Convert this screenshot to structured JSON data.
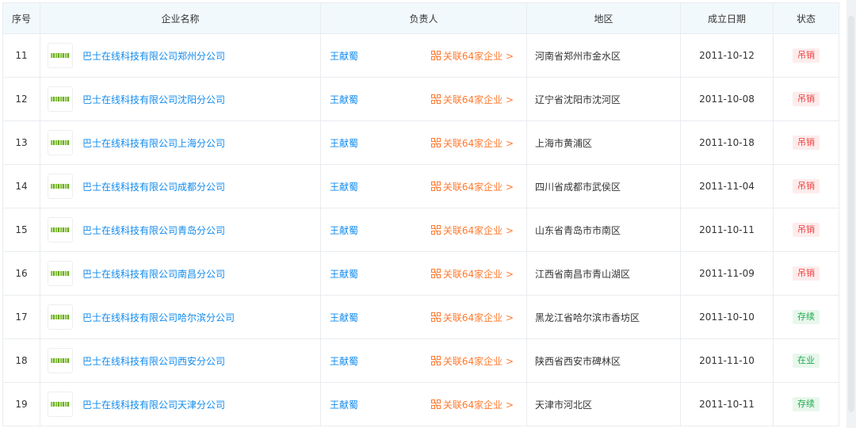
{
  "header": {
    "idx": "序号",
    "name": "企业名称",
    "person": "负责人",
    "region": "地区",
    "date": "成立日期",
    "status": "状态"
  },
  "colors": {
    "link": "#128bed",
    "assoc": "#ff7a30",
    "status_revoked": "#f04040",
    "status_active": "#1eaa4c"
  },
  "rows": [
    {
      "idx": "11",
      "name": "巴士在线科技有限公司郑州分公司",
      "person": "王献蜀",
      "assoc": "关联64家企业 >",
      "region": "河南省郑州市金水区",
      "date": "2011-10-12",
      "status": "吊销",
      "status_color": "red"
    },
    {
      "idx": "12",
      "name": "巴士在线科技有限公司沈阳分公司",
      "person": "王献蜀",
      "assoc": "关联64家企业 >",
      "region": "辽宁省沈阳市沈河区",
      "date": "2011-10-08",
      "status": "吊销",
      "status_color": "red"
    },
    {
      "idx": "13",
      "name": "巴士在线科技有限公司上海分公司",
      "person": "王献蜀",
      "assoc": "关联64家企业 >",
      "region": "上海市黄浦区",
      "date": "2011-10-18",
      "status": "吊销",
      "status_color": "red"
    },
    {
      "idx": "14",
      "name": "巴士在线科技有限公司成都分公司",
      "person": "王献蜀",
      "assoc": "关联64家企业 >",
      "region": "四川省成都市武侯区",
      "date": "2011-11-04",
      "status": "吊销",
      "status_color": "red"
    },
    {
      "idx": "15",
      "name": "巴士在线科技有限公司青岛分公司",
      "person": "王献蜀",
      "assoc": "关联64家企业 >",
      "region": "山东省青岛市市南区",
      "date": "2011-10-11",
      "status": "吊销",
      "status_color": "red"
    },
    {
      "idx": "16",
      "name": "巴士在线科技有限公司南昌分公司",
      "person": "王献蜀",
      "assoc": "关联64家企业 >",
      "region": "江西省南昌市青山湖区",
      "date": "2011-11-09",
      "status": "吊销",
      "status_color": "red"
    },
    {
      "idx": "17",
      "name": "巴士在线科技有限公司哈尔滨分公司",
      "person": "王献蜀",
      "assoc": "关联64家企业 >",
      "region": "黑龙江省哈尔滨市香坊区",
      "date": "2011-10-10",
      "status": "存续",
      "status_color": "green"
    },
    {
      "idx": "18",
      "name": "巴士在线科技有限公司西安分公司",
      "person": "王献蜀",
      "assoc": "关联64家企业 >",
      "region": "陕西省西安市碑林区",
      "date": "2011-11-10",
      "status": "在业",
      "status_color": "green"
    },
    {
      "idx": "19",
      "name": "巴士在线科技有限公司天津分公司",
      "person": "王献蜀",
      "assoc": "关联64家企业 >",
      "region": "天津市河北区",
      "date": "2011-10-11",
      "status": "存续",
      "status_color": "green"
    }
  ]
}
